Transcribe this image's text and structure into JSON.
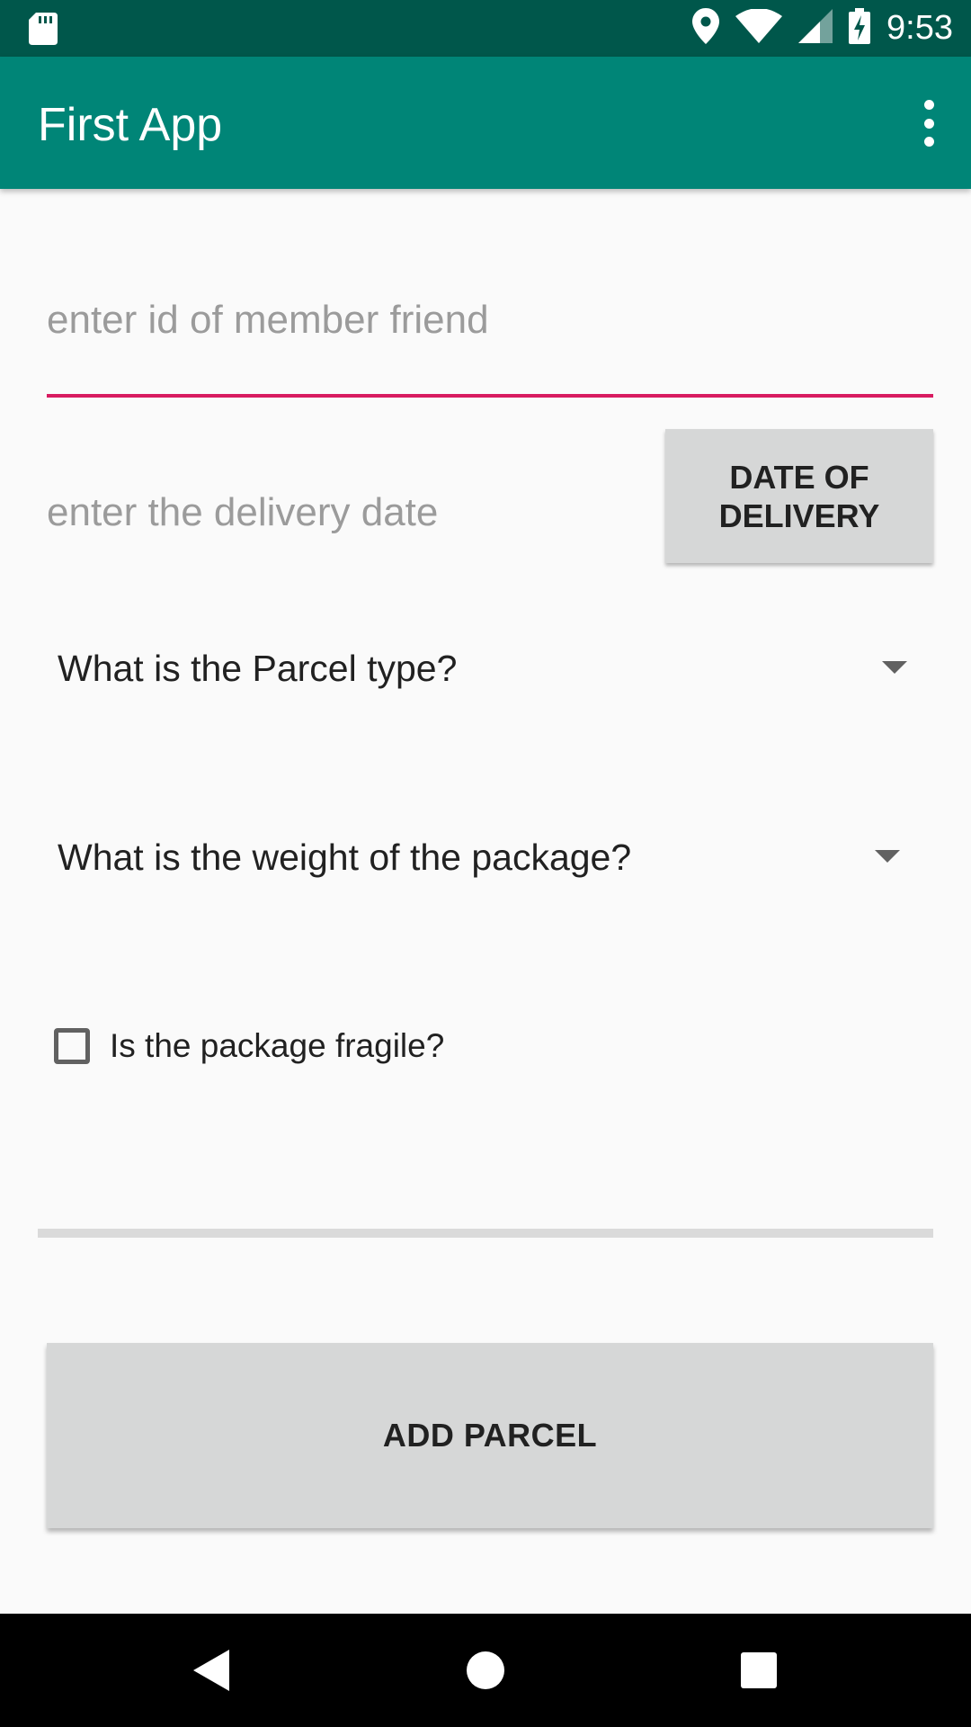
{
  "status_bar": {
    "time": "9:53",
    "icons": [
      "sd-card-icon",
      "location-icon",
      "wifi-icon",
      "signal-icon",
      "battery-charging-icon"
    ]
  },
  "app_bar": {
    "title": "First App",
    "overflow_icon": "more-vert-icon"
  },
  "form": {
    "member_id": {
      "value": "",
      "placeholder": "enter id of member friend",
      "underline_color": "#d81b60"
    },
    "delivery_date": {
      "value": "",
      "placeholder": "enter the delivery date",
      "button_label": "DATE OF DELIVERY"
    },
    "parcel_type": {
      "selected": "What is the Parcel type?"
    },
    "weight": {
      "selected": "What is the weight of the package?"
    },
    "fragile": {
      "label": "Is the package fragile?",
      "checked": false
    },
    "submit_label": "ADD PARCEL"
  },
  "nav_bar": {
    "icons": [
      "back-icon",
      "home-icon",
      "recents-icon"
    ]
  },
  "colors": {
    "status_bar": "#00574b",
    "app_bar": "#008577",
    "accent": "#d81b60",
    "button": "#d6d7d7"
  }
}
